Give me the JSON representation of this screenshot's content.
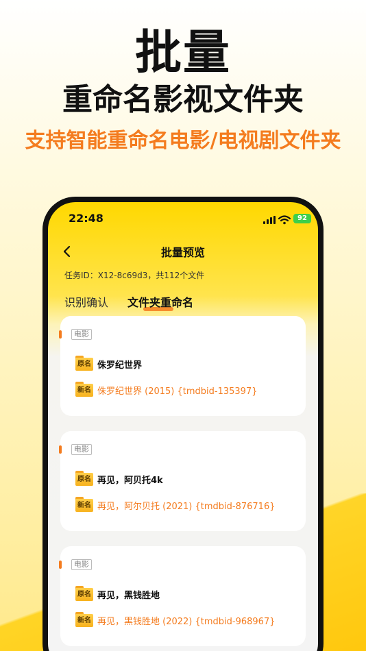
{
  "promo": {
    "title": "批量",
    "subtitle": "重命名影视文件夹",
    "tagline": "支持智能重命名电影/电视剧文件夹"
  },
  "status_bar": {
    "time": "22:48",
    "battery": "92"
  },
  "nav": {
    "title": "批量预览"
  },
  "task_info": "任务ID：X12-8c69d3，共112个文件",
  "tabs": [
    {
      "label": "识别确认",
      "active": false
    },
    {
      "label": "文件夹重命名",
      "active": true
    }
  ],
  "folder_badges": {
    "original": "原名",
    "new": "新名"
  },
  "cards": [
    {
      "category": "电影",
      "original_name": "侏罗纪世界",
      "new_name": "侏罗纪世界 (2015) {tmdbid-135397}"
    },
    {
      "category": "电影",
      "original_name": "再见，阿贝托4k",
      "new_name": "再见，阿尔贝托 (2021) {tmdbid-876716}"
    },
    {
      "category": "电影",
      "original_name": "再见，黑钱胜地",
      "new_name": "再见，黑钱胜地 (2022) {tmdbid-968967}"
    }
  ],
  "colors": {
    "accent": "#f47c1f",
    "header_yellow": "#ffd800",
    "folder": "#f7b21e"
  }
}
